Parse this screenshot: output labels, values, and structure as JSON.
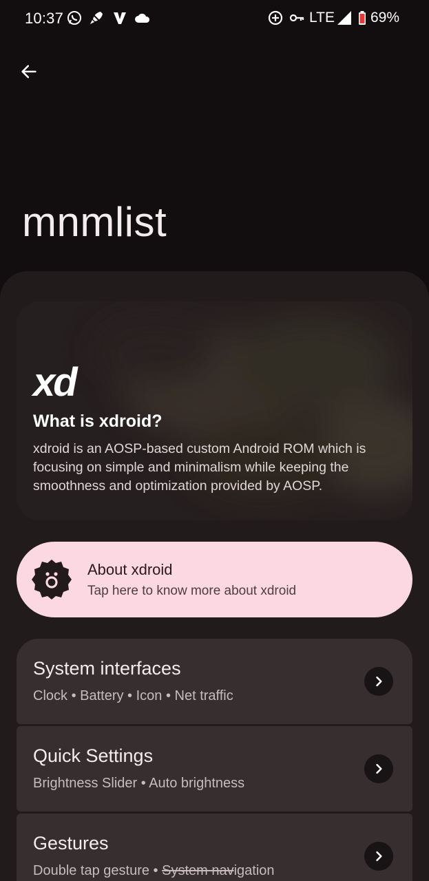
{
  "status_bar": {
    "time": "10:37",
    "network": "LTE",
    "battery": "69%",
    "left_icons": [
      "whatsapp-icon",
      "rocket-icon",
      "v-icon",
      "cloud-icon"
    ],
    "right_icons": [
      "data-saver-icon",
      "vpn-key-icon",
      "signal-icon",
      "battery-icon"
    ]
  },
  "header": {
    "title": "mnmlist"
  },
  "hero": {
    "logo_text": "xd",
    "title": "What is xdroid?",
    "description": "xdroid is an AOSP-based custom Android ROM which is focusing on simple and minimalism while keeping the smoothness and optimization provided by AOSP."
  },
  "about": {
    "title": "About xdroid",
    "subtitle": "Tap here to know more about xdroid"
  },
  "items": [
    {
      "title": "System interfaces",
      "subtitle": "Clock • Battery • Icon • Net traffic"
    },
    {
      "title": "Quick Settings",
      "subtitle": "Brightness Slider • Auto brightness"
    },
    {
      "title": "Gestures",
      "subtitle_plain": "Double tap gesture • ",
      "subtitle_struck": "System nav",
      "subtitle_rest": "igation"
    }
  ],
  "colors": {
    "background": "#120d0e",
    "sheet": "#221b1c",
    "card": "#362e2f",
    "accent_pink": "#fcd8e2"
  }
}
